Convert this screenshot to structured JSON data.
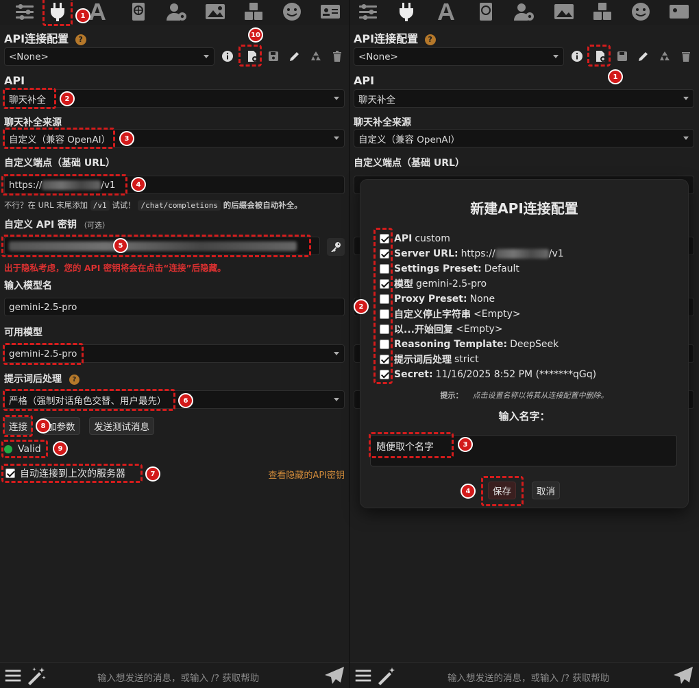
{
  "left": {
    "section_title": "API连接配置",
    "profile_select": "<None>",
    "api_label": "API",
    "api_select": "聊天补全",
    "source_label": "聊天补全来源",
    "source_select": "自定义（兼容 OpenAI）",
    "endpoint_label": "自定义端点（基础 URL）",
    "endpoint_prefix": "https://",
    "endpoint_suffix": "/v1",
    "hint_prefix": "不行？在 URL 末尾添加",
    "hint_code1": "/v1",
    "hint_mid": "试试！",
    "hint_code2": "/chat/completions",
    "hint_suffix": "的后缀会被自动补全。",
    "apikey_label": "自定义 API 密钥",
    "apikey_optional": "（可选）",
    "privacy_warning": "出于隐私考虑，您的 API 密钥将会在点击“连接”后隐藏。",
    "model_input_label": "输入模型名",
    "model_input_value": "gemini-2.5-pro",
    "available_models_label": "可用模型",
    "available_models_select": "gemini-2.5-pro",
    "postprocess_label": "提示词后处理",
    "postprocess_select": "严格（强制对话角色交替、用户最先）",
    "connect_button": "连接",
    "extra_params_button": "加参数",
    "send_test_button": "发送测试消息",
    "status_text": "Valid",
    "autoconnect_label": "自动连接到上次的服务器",
    "view_hidden_link": "查看隐藏的API密钥",
    "chat_placeholder": "输入想发送的消息，或输入 /? 获取帮助",
    "badges": [
      "1",
      "2",
      "3",
      "4",
      "5",
      "6",
      "7",
      "8",
      "9",
      "10"
    ]
  },
  "right": {
    "section_title": "API连接配置",
    "profile_select": "<None>",
    "api_label": "API",
    "api_select": "聊天补全",
    "source_label": "聊天补全来源",
    "source_select": "自定义（兼容 OpenAI）",
    "endpoint_label": "自定义端点（基础 URL）",
    "chat_placeholder": "输入想发送的消息，或输入 /? 获取帮助",
    "badges": [
      "1",
      "2",
      "3",
      "4"
    ]
  },
  "dialog": {
    "title": "新建API连接配置",
    "items": [
      {
        "key": "API",
        "value": "custom",
        "checked": true
      },
      {
        "key": "Server URL:",
        "value_prefix": "https://",
        "value_suffix": "/v1",
        "checked": true
      },
      {
        "key": "Settings Preset:",
        "value": "Default",
        "checked": false
      },
      {
        "key": "模型",
        "value": "gemini-2.5-pro",
        "checked": true
      },
      {
        "key": "Proxy Preset:",
        "value": "None",
        "checked": false
      },
      {
        "key": "自定义停止字符串",
        "value": "<Empty>",
        "checked": false
      },
      {
        "key": "以...开始回复",
        "value": "<Empty>",
        "checked": false
      },
      {
        "key": "Reasoning Template:",
        "value": "DeepSeek",
        "checked": false
      },
      {
        "key": "提示词后处理",
        "value": "strict",
        "checked": true
      },
      {
        "key": "Secret:",
        "value": "11/16/2025 8:52 PM (*******qGq)",
        "checked": true
      }
    ],
    "hint_label": "提示：",
    "hint_text": "点击设置名称以将其从连接配置中删除。",
    "name_label": "输入名字：",
    "name_value": "随便取个名字",
    "save_button": "保存",
    "cancel_button": "取消"
  },
  "colors": {
    "annotation": "#d41c1c",
    "accent_link": "#d08a3a",
    "warning": "#d93030",
    "valid": "#22aa44"
  }
}
